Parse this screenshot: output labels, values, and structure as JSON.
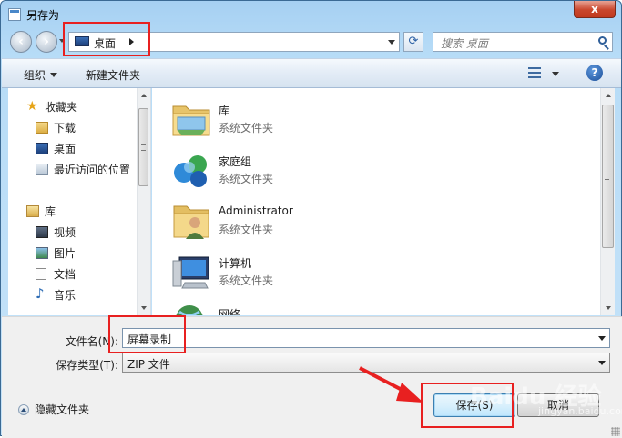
{
  "window": {
    "title": "另存为",
    "close_label": "x"
  },
  "nav": {
    "address_location": "桌面",
    "search_placeholder": "搜索 桌面"
  },
  "toolbar": {
    "organize_label": "组织",
    "new_folder_label": "新建文件夹",
    "help_label": "?"
  },
  "sidebar": {
    "items": [
      {
        "label": "收藏夹",
        "icon": "star-icon"
      },
      {
        "label": "下载",
        "icon": "download-folder-icon"
      },
      {
        "label": "桌面",
        "icon": "desktop-icon"
      },
      {
        "label": "最近访问的位置",
        "icon": "recent-places-icon"
      },
      {
        "label": "库",
        "icon": "library-icon"
      },
      {
        "label": "视频",
        "icon": "video-icon"
      },
      {
        "label": "图片",
        "icon": "picture-icon"
      },
      {
        "label": "文档",
        "icon": "document-icon"
      },
      {
        "label": "音乐",
        "icon": "music-icon"
      }
    ]
  },
  "files": [
    {
      "name": "库",
      "type": "系统文件夹",
      "icon": "library-folder-icon"
    },
    {
      "name": "家庭组",
      "type": "系统文件夹",
      "icon": "homegroup-icon"
    },
    {
      "name": "Administrator",
      "type": "系统文件夹",
      "icon": "user-folder-icon"
    },
    {
      "name": "计算机",
      "type": "系统文件夹",
      "icon": "computer-icon"
    },
    {
      "name": "网络",
      "type": "",
      "icon": "network-icon"
    }
  ],
  "form": {
    "filename_label": "文件名(N):",
    "filename_value": "屏幕录制",
    "filetype_label": "保存类型(T):",
    "filetype_value": "ZIP 文件"
  },
  "footer": {
    "hide_folders_label": "隐藏文件夹",
    "save_label": "保存(S)",
    "cancel_label": "取消"
  },
  "watermark": {
    "text": "Baidu 经验",
    "sub": "jingyan.baidu.com"
  },
  "colors": {
    "annotation": "#e82020",
    "titlebar": "#a6d0f2",
    "close": "#c9462c"
  }
}
